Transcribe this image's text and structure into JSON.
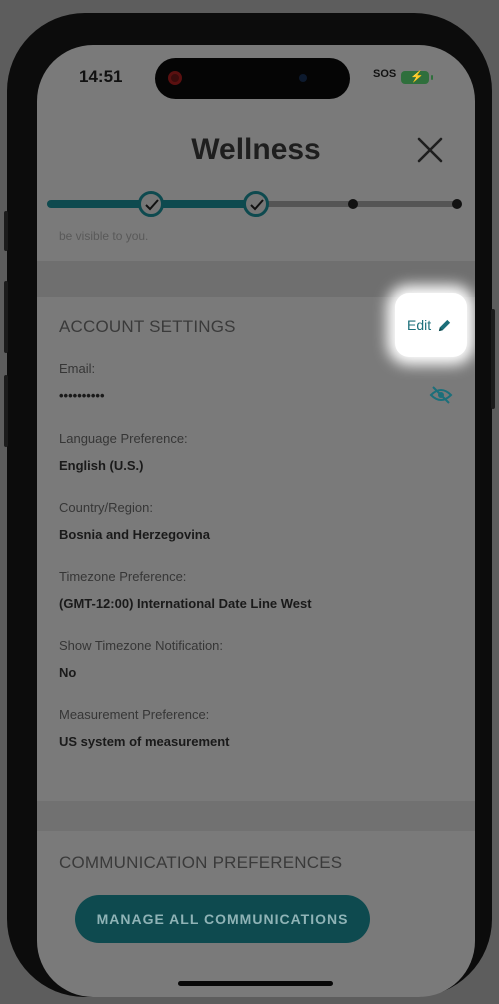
{
  "status_bar": {
    "time": "14:51",
    "sos": "SOS"
  },
  "header": {
    "title": "Wellness",
    "close_icon": "close-icon"
  },
  "progress": {
    "completed_steps": 2,
    "total_steps": 4
  },
  "intro": {
    "truncated_text": "be visible to you."
  },
  "account_settings": {
    "title": "ACCOUNT SETTINGS",
    "edit_label": "Edit",
    "edit_icon": "pencil-icon",
    "fields": [
      {
        "label": "Email:",
        "value": "••••••••••"
      },
      {
        "label": "Language Preference:",
        "value": "English (U.S.)"
      },
      {
        "label": "Country/Region:",
        "value": "Bosnia and Herzegovina"
      },
      {
        "label": "Timezone Preference:",
        "value": "(GMT-12:00) International Date Line West"
      },
      {
        "label": "Show Timezone Notification:",
        "value": "No"
      },
      {
        "label": "Measurement Preference:",
        "value": "US system of measurement"
      }
    ],
    "email_visibility_icon": "eye-slash-icon"
  },
  "communication": {
    "title": "COMMUNICATION PREFERENCES",
    "manage_button": "MANAGE ALL COMMUNICATIONS"
  },
  "colors": {
    "accent": "#0e4a4f",
    "link": "#1c6f7a",
    "overlay": "#7a7a7a"
  }
}
